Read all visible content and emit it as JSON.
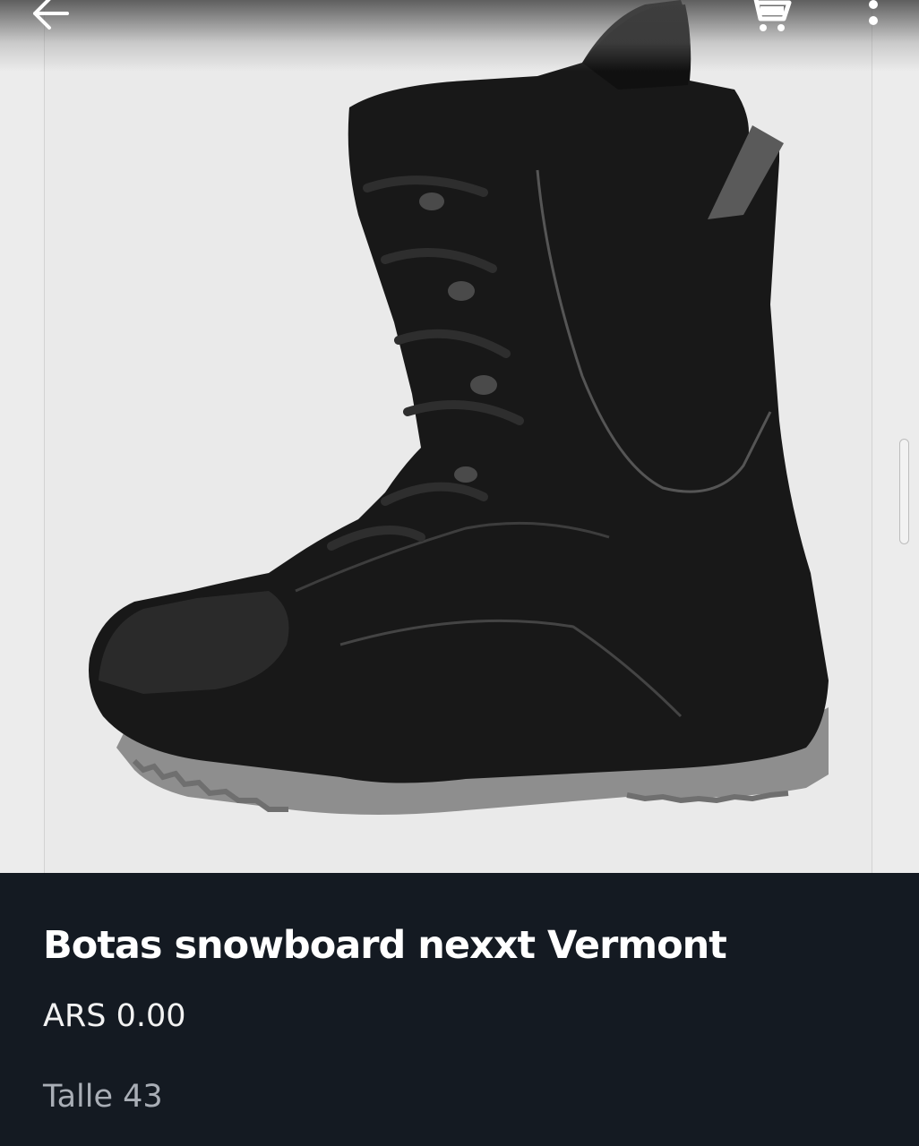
{
  "product": {
    "title": "Botas snowboard nexxt Vermont",
    "price": "ARS 0.00",
    "size": "Talle 43"
  },
  "toolbar": {
    "back_icon": "arrow-left-icon",
    "cart_icon": "shopping-cart-icon",
    "more_icon": "more-vertical-icon"
  },
  "colors": {
    "details_background": "#141a22",
    "image_background": "#eaeaea",
    "title_text": "#ffffff",
    "secondary_text": "#a9aeb6"
  }
}
